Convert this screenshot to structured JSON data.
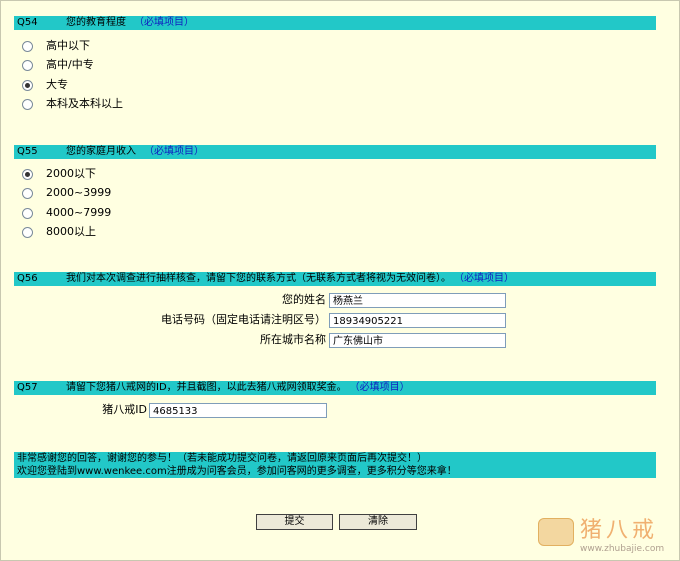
{
  "q54": {
    "num": "Q54",
    "title": "您的教育程度",
    "required": "（必填项目）",
    "options": [
      {
        "label": "高中以下",
        "selected": false
      },
      {
        "label": "高中/中专",
        "selected": false
      },
      {
        "label": "大专",
        "selected": true
      },
      {
        "label": "本科及本科以上",
        "selected": false
      }
    ]
  },
  "q55": {
    "num": "Q55",
    "title": "您的家庭月收入",
    "required": "（必填项目）",
    "options": [
      {
        "label": "2000以下",
        "selected": true
      },
      {
        "label": "2000~3999",
        "selected": false
      },
      {
        "label": "4000~7999",
        "selected": false
      },
      {
        "label": "8000以上",
        "selected": false
      }
    ]
  },
  "q56": {
    "num": "Q56",
    "title": "我们对本次调查进行抽样核查，请留下您的联系方式（无联系方式者将视为无效问卷）。",
    "required": "（必填项目）",
    "name_label": "您的姓名",
    "name_value": "杨燕兰",
    "phone_label": "电话号码（固定电话请注明区号）",
    "phone_value": "18934905221",
    "city_label": "所在城市名称",
    "city_value": "广东佛山市"
  },
  "q57": {
    "num": "Q57",
    "title": "请留下您猪八戒网的ID，并且截图，以此去猪八戒网领取奖金。",
    "required": "（必填项目）",
    "id_label": "猪八戒ID",
    "id_value": "4685133"
  },
  "notice": {
    "line1": "非常感谢您的回答，谢谢您的参与！（若未能成功提交问卷，请返回原来页面后再次提交！）",
    "line2": "欢迎您登陆到www.wenkee.com注册成为问客会员，参加问客网的更多调查，更多积分等您来拿！"
  },
  "buttons": {
    "submit": "提交",
    "clear": "清除"
  },
  "watermark": {
    "name": "猪八戒",
    "url": "www.zhubajie.com"
  }
}
